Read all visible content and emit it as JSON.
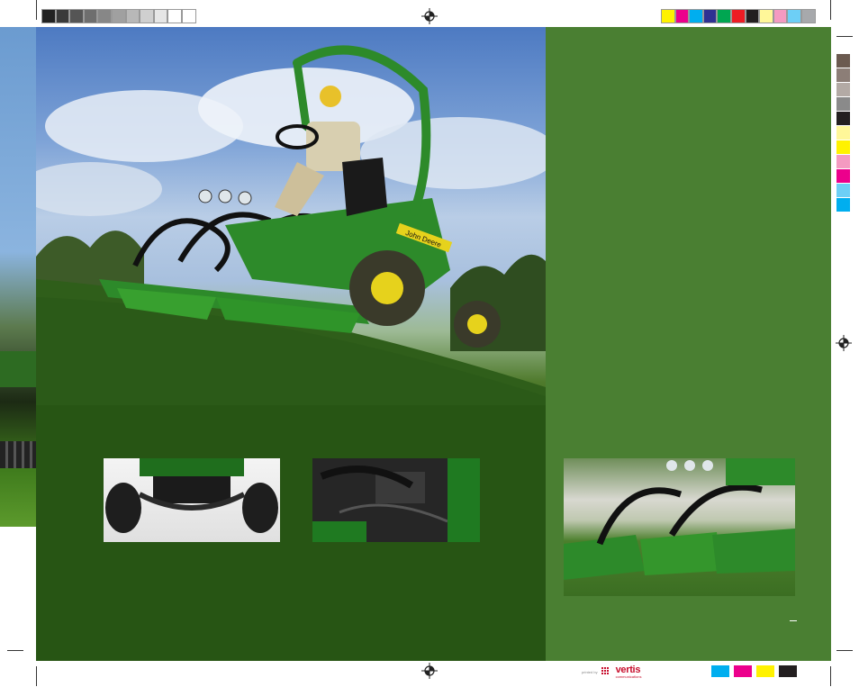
{
  "brand": {
    "logo_text": "vertis",
    "logo_subtext": "communications",
    "prefix": "printed by"
  },
  "mower_decal": "John Deere",
  "colors": {
    "panel_green": "#4a7f32",
    "tab_green": "#2f7a22",
    "mower_green": "#2d8a2a",
    "mower_yellow": "#e6d21c",
    "brand_red": "#c8102e"
  },
  "color_bars": {
    "grayscale": [
      "#222222",
      "#3a3a3a",
      "#555555",
      "#6e6e6e",
      "#878787",
      "#a0a0a0",
      "#b8b8b8",
      "#cfcfcf",
      "#e6e6e6",
      "#ffffff",
      "#ffffff"
    ],
    "process": [
      "#fff200",
      "#ec008c",
      "#00aeef",
      "#2e3192",
      "#00a651",
      "#ed1c24",
      "#231f20",
      "#fff799",
      "#f49ac1",
      "#6dcff6",
      "#a7a9ac"
    ],
    "vertical": [
      "#6b5a50",
      "#8c7e77",
      "#b3aaa5",
      "#8a8a8a",
      "#231f20",
      "#fff799",
      "#fff200",
      "#f49ac1",
      "#ec008c",
      "#6dcff6",
      "#00aeef"
    ],
    "bottom_process": [
      "#00aeef",
      "#ec008c",
      "#fff200",
      "#231f20"
    ]
  }
}
